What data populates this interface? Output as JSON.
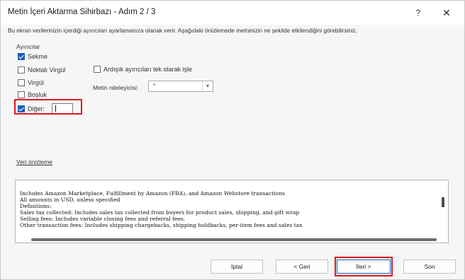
{
  "window": {
    "title": "Metin İçeri Aktarma Sihirbazı - Adım 2 / 3",
    "help_label": "?",
    "close_label": "✕"
  },
  "description": "Bu ekran verilerinizin içerdiği ayırıcıları ayarlamanıza olanak verir. Aşağıdaki önizlemede metninizin ne şekilde etkilendiğini görebilirsiniz.",
  "delimiters": {
    "group_label": "Ayırıcılar",
    "items": [
      {
        "label": "Sekme",
        "checked": true
      },
      {
        "label": "Noktalı Virgül",
        "checked": false
      },
      {
        "label": "Virgül",
        "checked": false
      },
      {
        "label": "Boşluk",
        "checked": false
      },
      {
        "label": "Diğer:",
        "checked": true,
        "value": ""
      }
    ]
  },
  "consecutive": {
    "label": "Ardışık ayırıcıları tek olarak işle",
    "checked": false
  },
  "qualifier": {
    "label": "Metin niteleyicisi:",
    "value": "\""
  },
  "preview": {
    "label": "Veri önizleme",
    "lines": [
      "Includes Amazon Marketplace, Fulfillment by Amazon (FBA), and Amazon Webstore transactions",
      "All amounts in USD, unless specified",
      "Definitions:",
      "Sales tax collected: Includes sales tax collected from buyers for product sales, shipping, and gift wrap",
      "Selling fees: Includes variable closing fees and referral fees.",
      "Other transaction fees: Includes shipping chargebacks, shipping holdbacks, per-item fees  and sales tax"
    ]
  },
  "buttons": {
    "cancel": "İptal",
    "back": "< Geri",
    "next": "İleri >",
    "finish": "Son"
  },
  "colors": {
    "accent": "#1f5fb4",
    "highlight": "#e0161e"
  },
  "icons": {
    "dropdown": "chevron-down-icon",
    "close": "close-icon",
    "help": "help-icon"
  }
}
